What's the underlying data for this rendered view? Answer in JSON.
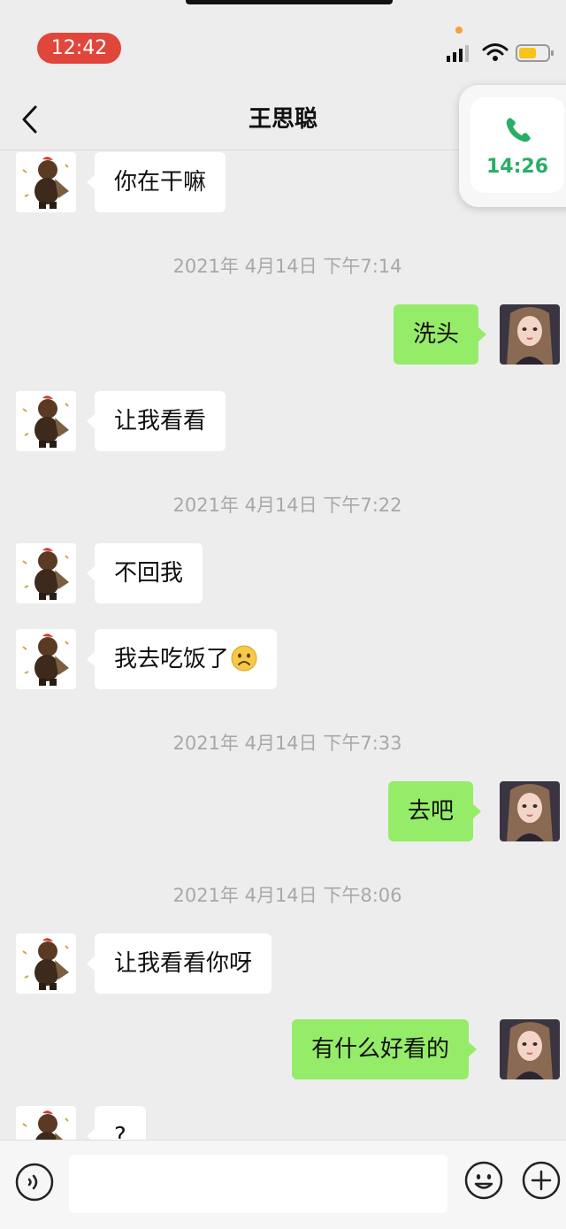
{
  "status_bar": {
    "time": "12:42"
  },
  "header": {
    "title": "王思聪"
  },
  "call_float": {
    "duration": "14:26"
  },
  "messages": {
    "m1": "你在干嘛",
    "t1": "2021年 4月14日 下午7:14",
    "m2": "洗头",
    "m3": "让我看看",
    "t2": "2021年 4月14日 下午7:22",
    "m4": "不回我",
    "m5": "我去吃饭了",
    "t3": "2021年 4月14日 下午7:33",
    "m6": "去吧",
    "t4": "2021年 4月14日 下午8:06",
    "m7": "让我看看你呀",
    "m8": "有什么好看的",
    "m9": "?"
  },
  "input_bar": {
    "value": "",
    "placeholder": ""
  },
  "colors": {
    "background": "#ededed",
    "bubble_self": "#95ec69",
    "bubble_other": "#ffffff",
    "time_pill": "#e0463a",
    "call_green": "#2aae67"
  },
  "icons": [
    "back-icon",
    "phone-icon",
    "signal-icon",
    "wifi-icon",
    "battery-icon",
    "voice-icon",
    "emoji-icon",
    "plus-icon",
    "frown-emoji-icon"
  ]
}
